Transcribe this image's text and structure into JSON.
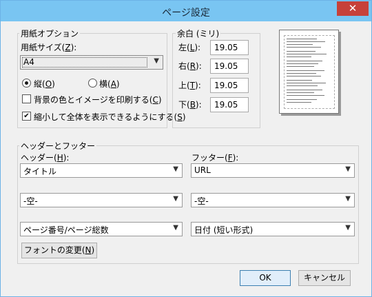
{
  "window": {
    "title": "ページ設定",
    "close_glyph": "✕"
  },
  "paper": {
    "group_label": "用紙オプション",
    "size_label": "用紙サイズ(",
    "size_key": "Z",
    "size_label_end": "):",
    "size_value": "A4",
    "portrait_label": "縦(",
    "portrait_key": "O",
    "portrait_end": ")",
    "landscape_label": "横(",
    "landscape_key": "A",
    "landscape_end": ")",
    "orientation_selected": "portrait",
    "bg_label": "背景の色とイメージを印刷する(",
    "bg_key": "C",
    "bg_end": ")",
    "bg_checked": false,
    "shrink_label": "縮小して全体を表示できるようにする(",
    "shrink_key": "S",
    "shrink_end": ")",
    "shrink_checked": true,
    "check_glyph": "✔"
  },
  "margins": {
    "group_label": "余白 (ミリ)",
    "left_label": "左(",
    "left_key": "L",
    "left_end": "):",
    "left_value": "19.05",
    "right_label": "右(",
    "right_key": "R",
    "right_end": "):",
    "right_value": "19.05",
    "top_label": "上(",
    "top_key": "T",
    "top_end": "):",
    "top_value": "19.05",
    "bottom_label": "下(",
    "bottom_key": "B",
    "bottom_end": "):",
    "bottom_value": "19.05"
  },
  "header_footer": {
    "group_label": "ヘッダーとフッター",
    "header_label": "ヘッダー(",
    "header_key": "H",
    "header_end": "):",
    "footer_label": "フッター(",
    "footer_key": "F",
    "footer_end": "):",
    "header_values": [
      "タイトル",
      "-空-",
      "ページ番号/ページ総数"
    ],
    "footer_values": [
      "URL",
      "-空-",
      "日付 (短い形式)"
    ],
    "font_button_label": "フォントの変更(",
    "font_button_key": "N",
    "font_button_end": ")"
  },
  "buttons": {
    "ok": "OK",
    "cancel": "キャンセル"
  },
  "icons": {
    "dropdown": "▼",
    "dropdown_name": "chevron-down-icon"
  }
}
